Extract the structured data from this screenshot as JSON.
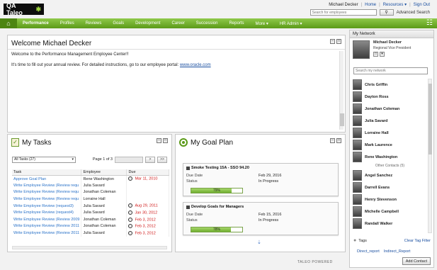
{
  "header": {
    "logo_text": "QA Taleo",
    "user_name": "Michael Decker",
    "links": [
      "Home",
      "Resources ▾",
      "Sign Out"
    ],
    "search_placeholder": "Search for employees",
    "advanced_search": "Advanced Search"
  },
  "nav": {
    "items": [
      "Performance",
      "Profiles",
      "Reviews",
      "Goals",
      "Development",
      "Career",
      "Succession",
      "Reports",
      "More ▾",
      "HR Admin ▾"
    ],
    "active": "Performance"
  },
  "welcome": {
    "title": "Welcome Michael Decker",
    "line1": "Welcome to the Performance Management Employee Center!!",
    "line2": "It's time to fill out your annual review. For detailed instructions, go to our employee portal:",
    "link": "www.oracle.com"
  },
  "tasks": {
    "title": "My Tasks",
    "filter": "All Tasks (27)",
    "page_label": "Page 1 of 3",
    "pager_buttons": [
      ">",
      ">>"
    ],
    "columns": [
      "Task",
      "Employee",
      "Due"
    ],
    "rows": [
      {
        "task": "Approve Goal Plan",
        "employee": "Rene Washington",
        "due": "Mar 11, 2010",
        "overdue": true
      },
      {
        "task": "Write Employee Review (Review requ",
        "employee": "Julia Savard",
        "due": "",
        "overdue": false
      },
      {
        "task": "Write Employee Review (Review requ",
        "employee": "Jonathan Coleman",
        "due": "",
        "overdue": false
      },
      {
        "task": "Write Employee Review (Review requ",
        "employee": "Lorraine Hall",
        "due": "",
        "overdue": false
      },
      {
        "task": "Write Employee Review (request3)",
        "employee": "Julia Savard",
        "due": "Aug 29, 2011",
        "overdue": true
      },
      {
        "task": "Write Employee Review (request4)",
        "employee": "Julia Savard",
        "due": "Jan 30, 2012",
        "overdue": true
      },
      {
        "task": "Write Employee Review (Review 2009",
        "employee": "Jonathan Coleman",
        "due": "Feb 3, 2012",
        "overdue": true
      },
      {
        "task": "Write Employee Review (Review 2011",
        "employee": "Jonathan Coleman",
        "due": "Feb 3, 2012",
        "overdue": true
      },
      {
        "task": "Write Employee Review (Review 2011",
        "employee": "Julia Savard",
        "due": "Feb 3, 2012",
        "overdue": true
      }
    ]
  },
  "goals": {
    "title": "My Goal Plan",
    "items": [
      {
        "title": "Smoke Testing 15A - SSO 94.20",
        "due_label": "Due Date",
        "due": "Feb 29, 2016",
        "status_label": "Status",
        "status": "In Progress",
        "progress": 79,
        "progress_label": "79%"
      },
      {
        "title": "Develop Goals for Managers",
        "due_label": "Due Date",
        "due": "Feb 15, 2016",
        "status_label": "Status",
        "status": "In Progress",
        "progress": 78,
        "progress_label": "78%"
      }
    ],
    "more_icon": "double-chevron-down-icon"
  },
  "footer": {
    "powered": "TALEO POWERED"
  },
  "network": {
    "title": "My Network",
    "me": {
      "name": "Michael Decker",
      "role": "Regional Vice President"
    },
    "search_placeholder": "Search my network",
    "contacts": [
      "Chris Griffin",
      "Dayton Ross",
      "Jonathan Coleman",
      "Julia Savard",
      "Lorraine Hall",
      "Mark Laurence",
      "Rene Washington"
    ],
    "other_label": "Other Contacts (5)",
    "others": [
      "Angel Sanchez",
      "Darrell Evans",
      "Henry Stevenson",
      "Michelle Campbell",
      "Randall Walker"
    ],
    "tags_label": "Tags",
    "clear_tag_filter": "Clear Tag Filter",
    "tag_links": [
      "Direct_report",
      "Indirect_Report"
    ],
    "add_contact": "Add Contact"
  }
}
